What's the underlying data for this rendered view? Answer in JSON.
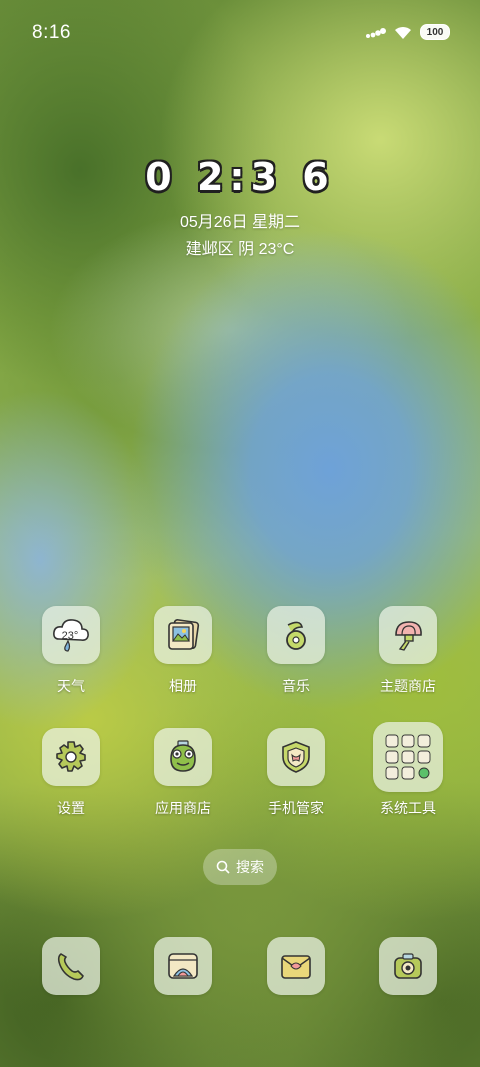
{
  "status_bar": {
    "time": "8:16",
    "battery": "100",
    "icons": [
      "signal-icon",
      "wifi-icon",
      "battery-icon"
    ]
  },
  "lock_clock": {
    "time": "0 2:3 6",
    "date": "05月26日 星期二",
    "weather": "建邺区 阴 23°C"
  },
  "apps": [
    {
      "label": "天气",
      "icon": "weather-icon",
      "icon_text": "23°"
    },
    {
      "label": "相册",
      "icon": "gallery-icon"
    },
    {
      "label": "音乐",
      "icon": "music-icon"
    },
    {
      "label": "主题商店",
      "icon": "theme-store-icon"
    },
    {
      "label": "设置",
      "icon": "gear-icon"
    },
    {
      "label": "应用商店",
      "icon": "app-store-icon"
    },
    {
      "label": "手机管家",
      "icon": "security-icon"
    },
    {
      "label": "系统工具",
      "icon": "folder-icon"
    }
  ],
  "search": {
    "label": "搜索"
  },
  "dock": [
    {
      "icon": "phone-icon"
    },
    {
      "icon": "browser-icon"
    },
    {
      "icon": "messages-icon"
    },
    {
      "icon": "camera-icon"
    }
  ]
}
